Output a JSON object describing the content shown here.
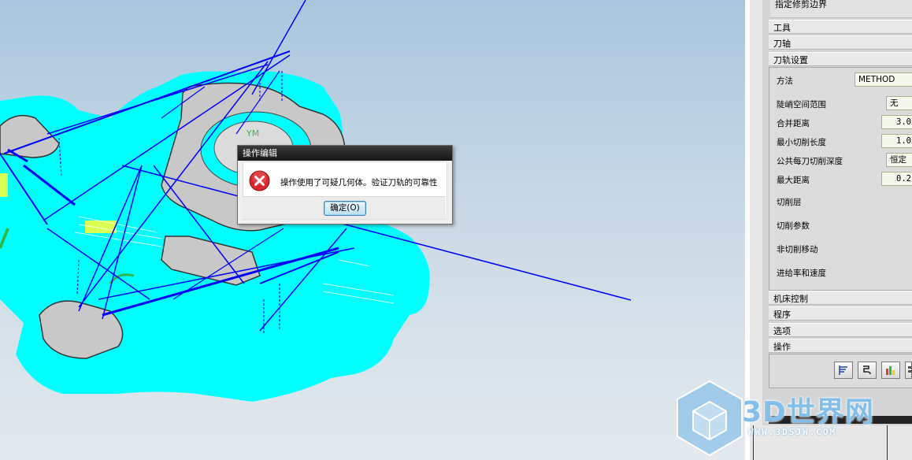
{
  "viewport": {
    "axis_label": "YM",
    "colors": {
      "stock": "#00ffff",
      "part": "#c9c9c9",
      "toolpath": "#0000ff",
      "background_top": "#a9c6de",
      "background_bottom": "#e4e9ee"
    }
  },
  "dialog": {
    "title": "操作编辑",
    "message": "操作使用了可疑几何体。验证刀轨的可靠性",
    "ok_label": "确定(O)",
    "icon": "error-icon"
  },
  "panel": {
    "trim_label": "指定修剪边界",
    "sections": {
      "tool": "工具",
      "axis": "刀轴",
      "path_settings": "刀轨设置",
      "machine_control": "机床控制",
      "program": "程序",
      "options": "选项",
      "actions": "操作"
    },
    "fields": {
      "method_label": "方法",
      "method_value": "METHOD",
      "steep_label": "陡峭空间范围",
      "steep_value": "无",
      "merge_label": "合并距离",
      "merge_value": "3.0",
      "min_cut_label": "最小切削长度",
      "min_cut_value": "1.0",
      "depth_label": "公共每刀切削深度",
      "depth_value": "恒定",
      "max_dist_label": "最大距离",
      "max_dist_value": "0.2",
      "cut_levels_label": "切削层",
      "cut_params_label": "切削参数",
      "non_cut_label": "非切削移动",
      "feeds_label": "进给率和速度"
    },
    "action_icons": [
      "generate-icon",
      "replay-icon",
      "verify-icon",
      "list-icon"
    ]
  },
  "watermark": {
    "title": "3D世界网",
    "url": "WWW.3DSJW.COM"
  }
}
